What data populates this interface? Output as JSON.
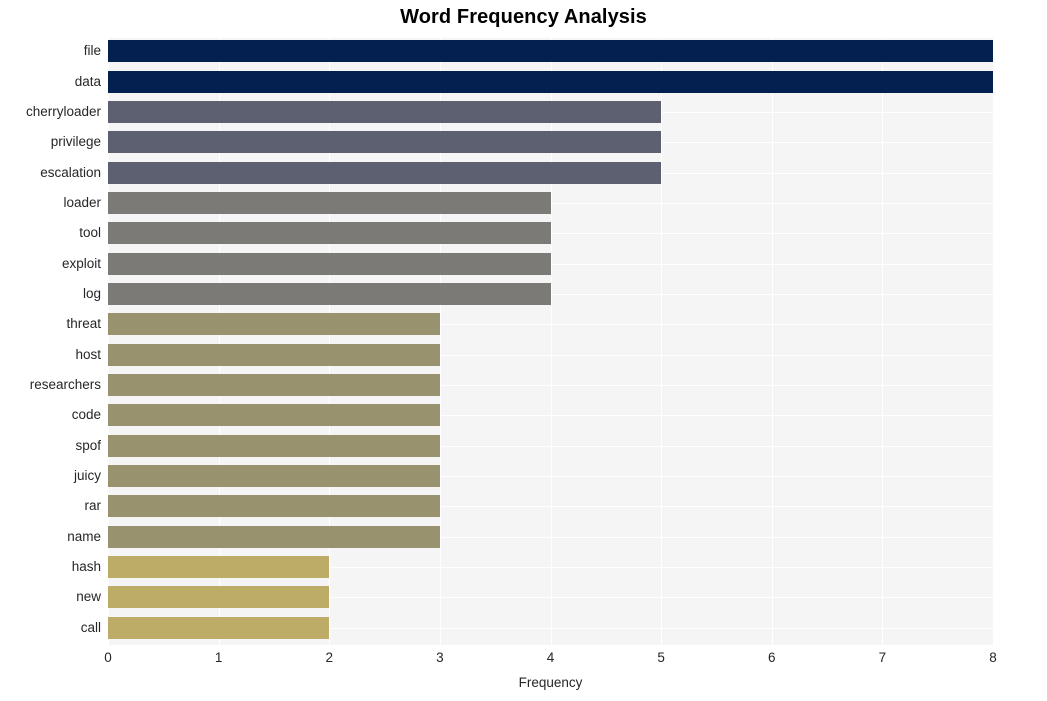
{
  "chart_data": {
    "type": "bar",
    "orientation": "horizontal",
    "title": "Word Frequency Analysis",
    "xlabel": "Frequency",
    "ylabel": "",
    "xlim": [
      0,
      8
    ],
    "xticks": [
      0,
      1,
      2,
      3,
      4,
      5,
      6,
      7,
      8
    ],
    "xtick_labels": [
      "0",
      "1",
      "2",
      "3",
      "4",
      "5",
      "6",
      "7",
      "8"
    ],
    "grid": true,
    "legend": null,
    "categories": [
      "file",
      "data",
      "cherryloader",
      "privilege",
      "escalation",
      "loader",
      "tool",
      "exploit",
      "log",
      "threat",
      "host",
      "researchers",
      "code",
      "spof",
      "juicy",
      "rar",
      "name",
      "hash",
      "new",
      "call"
    ],
    "values": [
      8,
      8,
      5,
      5,
      5,
      4,
      4,
      4,
      4,
      3,
      3,
      3,
      3,
      3,
      3,
      3,
      3,
      2,
      2,
      2
    ],
    "bar_colors": [
      "#042050",
      "#042050",
      "#5c6070",
      "#5c6070",
      "#5c6070",
      "#7b7a76",
      "#7b7a76",
      "#7b7a76",
      "#7b7a76",
      "#99926f",
      "#99926f",
      "#99926f",
      "#99926f",
      "#99926f",
      "#99926f",
      "#99926f",
      "#99926f",
      "#bdac68",
      "#bdac68",
      "#bdac68"
    ],
    "plot_background": "#f5f5f5",
    "grid_color": "#ffffff",
    "text_color": "#262626"
  }
}
